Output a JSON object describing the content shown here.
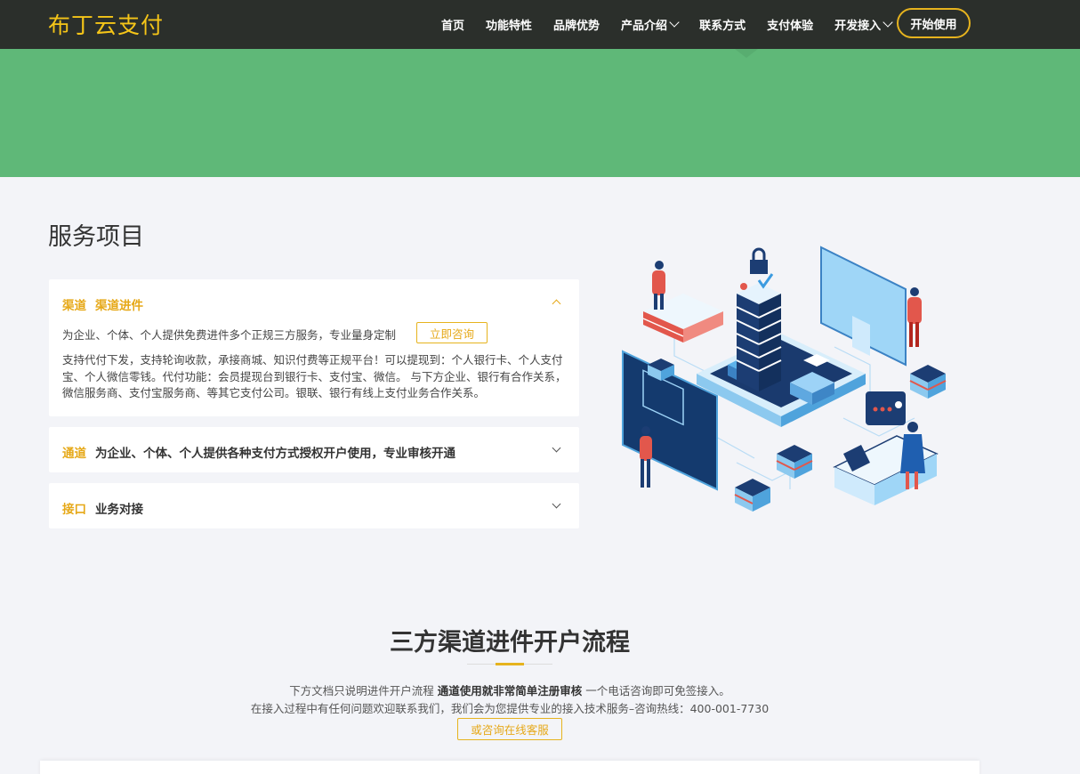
{
  "brand": {
    "name": "布丁云支付",
    "accent": "#f5c518",
    "green": "#5fb878"
  },
  "nav": {
    "items": [
      {
        "label": "首页",
        "dropdown": false
      },
      {
        "label": "功能特性",
        "dropdown": false
      },
      {
        "label": "品牌优势",
        "dropdown": false
      },
      {
        "label": "产品介绍",
        "dropdown": true
      },
      {
        "label": "联系方式",
        "dropdown": false
      },
      {
        "label": "支付体验",
        "dropdown": false
      },
      {
        "label": "开发接入",
        "dropdown": true
      }
    ],
    "cta": "开始使用"
  },
  "services": {
    "title": "服务项目",
    "panels": [
      {
        "tag": "渠道",
        "heading": "渠道进件",
        "expanded": true,
        "intro": "为企业、个体、个人提供免费进件多个正规三方服务，专业量身定制",
        "button": "立即咨询",
        "body": "支持代付下发，支持轮询收款，承接商城、知识付费等正规平台！可以提现到：个人银行卡、个人支付宝、个人微信零钱。代付功能：会员提现台到银行卡、支付宝、微信。 与下方企业、银行有合作关系，微信服务商、支付宝服务商、等其它支付公司。银联、银行有线上支付业务合作关系。"
      },
      {
        "tag": "通道",
        "heading": "为企业、个体、个人提供各种支付方式授权开户使用，专业审核开通",
        "expanded": false
      },
      {
        "tag": "接口",
        "heading": "业务对接",
        "expanded": false
      }
    ]
  },
  "flow": {
    "title": "三方渠道进件开户流程",
    "line1_pre": "下方文档只说明进件开户流程 ",
    "line1_bold": "通道使用就非常简单注册审核",
    "line1_post": " 一个电话咨询即可免签接入。",
    "line2": "在接入过程中有任何问题欢迎联系我们，我们会为您提供专业的接入技术服务–咨询热线：400-001-7730",
    "button": "或咨询在线客服"
  }
}
